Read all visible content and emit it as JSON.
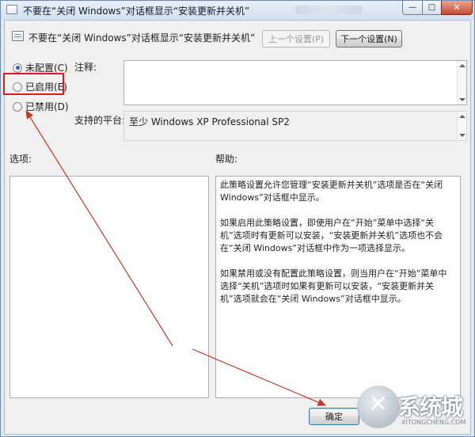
{
  "window": {
    "title": "不要在“关闭 Windows”对话框显示“安装更新并关机”",
    "minimize_glyph": "—",
    "maximize_glyph": "□",
    "close_glyph": "✕"
  },
  "header": {
    "setting_title": "不要在“关闭 Windows”对话框显示“安装更新并关机”",
    "prev_button": "上一个设置(P)",
    "next_button": "下一个设置(N)"
  },
  "radios": [
    {
      "label": "未配置(C)",
      "checked": true
    },
    {
      "label": "已启用(E)",
      "checked": false
    },
    {
      "label": "已禁用(D)",
      "checked": false
    }
  ],
  "labels": {
    "comment": "注释:",
    "platform": "支持的平台:",
    "options": "选项:",
    "help": "帮助:"
  },
  "platform_value": "至少 Windows XP Professional SP2",
  "help_text": [
    "此策略设置允许您管理“安装更新并关机”选项是否在“关闭 Windows”对话框中显示。",
    "如果启用此策略设置，即使用户在“开始”菜单中选择“关机”选项时有更新可以安装，“安装更新并关机”选项也不会在“关闭 Windows”对话框中作为一项选择显示。",
    "如果禁用或没有配置此策略设置，则当用户在“开始”菜单中选择“关机”选项时如果有更新可以安装，“安装更新并关机”选项就会在“关闭 Windows”对话框中显示。"
  ],
  "ok_button": "确定",
  "watermark": {
    "text": "系统城",
    "url": "XITONGCHENG.COM"
  },
  "colors": {
    "highlight": "#d81e1e",
    "annotation_arrow": "#c0392b"
  }
}
